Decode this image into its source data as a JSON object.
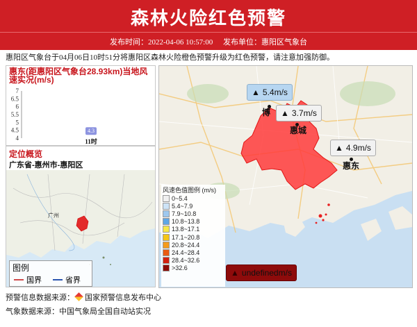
{
  "header": {
    "title": "森林火险红色预警",
    "publish_time": "发布时间：2022-04-06 10:57:00",
    "publisher": "发布单位：惠阳区气象台"
  },
  "intro": "惠阳区气象台于04月06日10时51分将惠阳区森林火险橙色预警升级为红色预警，请注意加强防御。",
  "wind_chart": {
    "title": "惠东(距惠阳区气象台28.93km)当地风速实况(m/s)",
    "chart_data": {
      "type": "bar",
      "title": "惠东(距惠阳区气象台28.93km)当地风速实况(m/s)",
      "categories": [
        "11时"
      ],
      "values": [
        4.3
      ],
      "ylim": [
        4,
        7
      ],
      "yticks": [
        "7",
        "6.5",
        "6",
        "5.5",
        "5",
        "4.5",
        "4"
      ]
    }
  },
  "location": {
    "title": "定位概览",
    "region": "广东省-惠州市-惠阳区",
    "mini_map_label": "广州"
  },
  "map_legend": {
    "title": "图例",
    "national_border": "国界",
    "provincial_border": "省界"
  },
  "wind_legend": {
    "title": "风速色值图例 (m/s)",
    "items": [
      {
        "label": "0~5.4",
        "color": "#f0f0f0"
      },
      {
        "label": "5.4~7.9",
        "color": "#cde3f6"
      },
      {
        "label": "7.9~10.8",
        "color": "#9ec8ee"
      },
      {
        "label": "10.8~13.8",
        "color": "#5ea7e6"
      },
      {
        "label": "13.8~17.1",
        "color": "#f6e84a"
      },
      {
        "label": "17.1~20.8",
        "color": "#f4c617"
      },
      {
        "label": "20.8~24.4",
        "color": "#f49b1c"
      },
      {
        "label": "24.4~28.4",
        "color": "#ea5b12"
      },
      {
        "label": "28.4~32.6",
        "color": "#d2200f"
      },
      {
        "label": ">32.6",
        "color": "#8c0b06"
      }
    ]
  },
  "stations": [
    {
      "label": "5.4m/s",
      "color": "#b7d6f1"
    },
    {
      "label": "3.7m/s",
      "color": "#f2f2f2"
    },
    {
      "label": "4.9m/s",
      "color": "#f2f2f2"
    },
    {
      "label": "undefinedm/s",
      "color": "#8e0b0b"
    }
  ],
  "cities": {
    "bo": "博",
    "huicheng": "惠城",
    "huidong": "惠东"
  },
  "footer": {
    "warning_source_label": "预警信息数据来源：",
    "warning_source": "国家预警信息发布中心",
    "weather_source": "气象数据来源：中国气象局全国自动站实况"
  },
  "colors": {
    "header_red": "#cf1f25",
    "alert_area": "#ff3b3b"
  }
}
